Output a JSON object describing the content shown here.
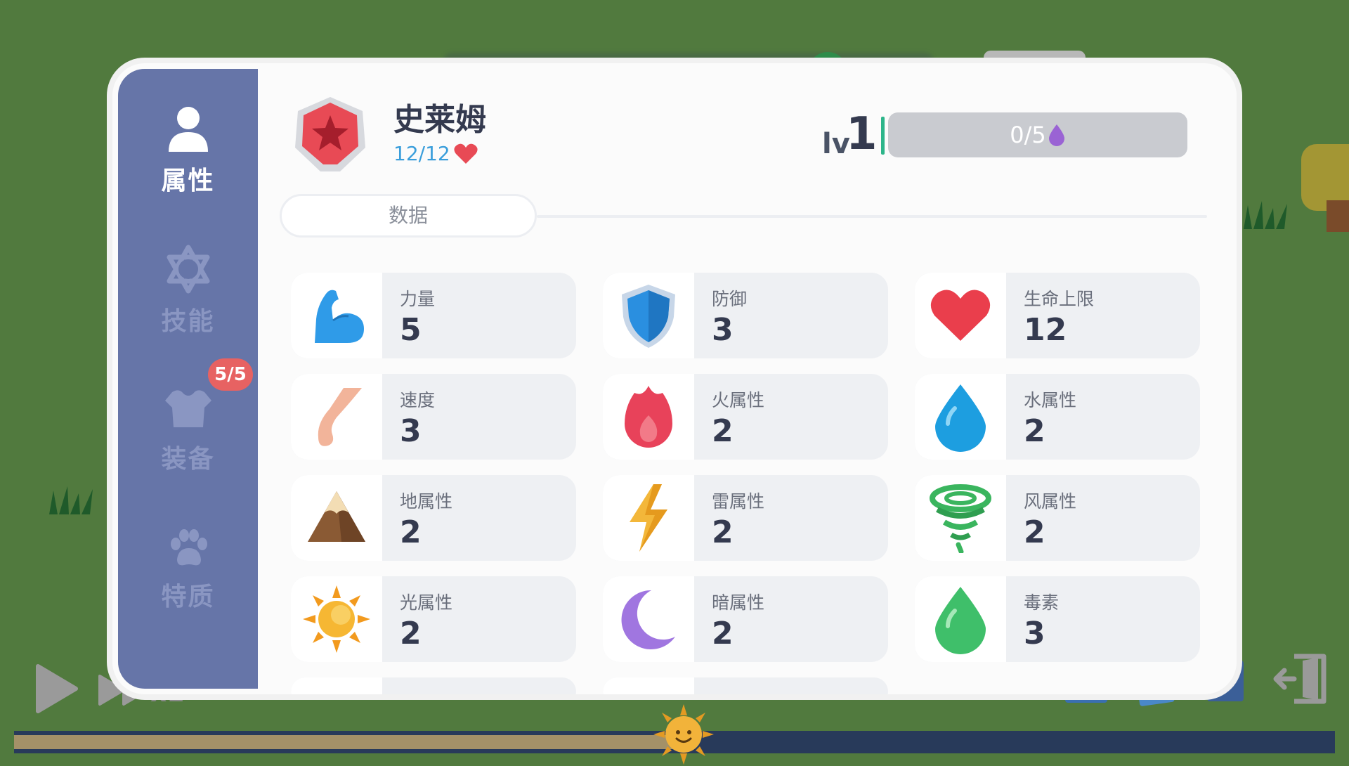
{
  "colors": {
    "background": "#517a3e",
    "sidebar": "#6675a8",
    "accent_hp": "#3a9edb",
    "badge": "#e76262"
  },
  "sidebar": {
    "items": [
      {
        "label": "属性",
        "icon": "person-icon",
        "active": true
      },
      {
        "label": "技能",
        "icon": "star-of-david-icon",
        "active": false
      },
      {
        "label": "装备",
        "icon": "armor-icon",
        "active": false
      },
      {
        "label": "特质",
        "icon": "paw-icon",
        "active": false
      }
    ],
    "equip_badge": "5/5"
  },
  "character": {
    "name": "史莱姆",
    "hp": "12/12",
    "avatar_icon": "red-star-badge-icon",
    "level_prefix": "lv",
    "level": "1",
    "exp": "0/5"
  },
  "tabs": {
    "data_label": "数据"
  },
  "stats": [
    {
      "label": "力量",
      "value": "5",
      "icon": "flexed-arm-icon"
    },
    {
      "label": "防御",
      "value": "3",
      "icon": "shield-icon"
    },
    {
      "label": "生命上限",
      "value": "12",
      "icon": "heart-icon"
    },
    {
      "label": "速度",
      "value": "3",
      "icon": "leg-icon"
    },
    {
      "label": "火属性",
      "value": "2",
      "icon": "fire-icon"
    },
    {
      "label": "水属性",
      "value": "2",
      "icon": "water-drop-icon"
    },
    {
      "label": "地属性",
      "value": "2",
      "icon": "mountain-icon"
    },
    {
      "label": "雷属性",
      "value": "2",
      "icon": "lightning-icon"
    },
    {
      "label": "风属性",
      "value": "2",
      "icon": "tornado-icon"
    },
    {
      "label": "光属性",
      "value": "2",
      "icon": "sun-icon"
    },
    {
      "label": "暗属性",
      "value": "2",
      "icon": "moon-icon"
    },
    {
      "label": "毒素",
      "value": "3",
      "icon": "poison-drop-icon"
    }
  ],
  "controls": {
    "speed": "x1"
  },
  "timeline": {
    "progress": 0.5
  }
}
